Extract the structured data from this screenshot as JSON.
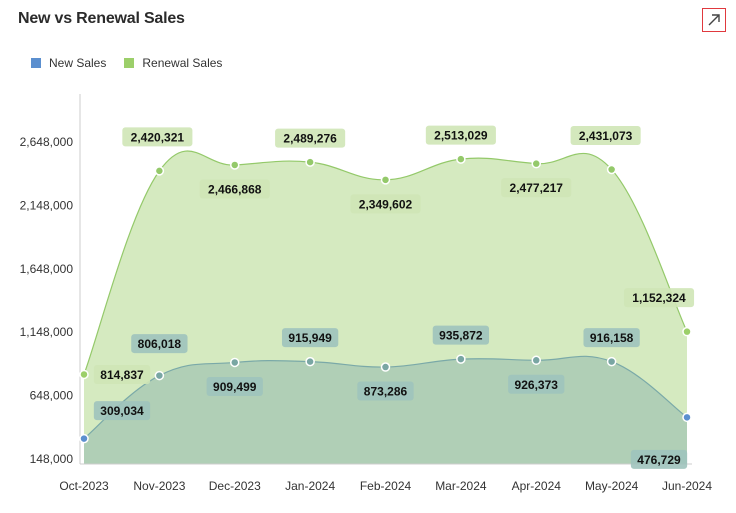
{
  "header": {
    "title": "New vs Renewal Sales",
    "expand_icon": "arrow-up-right-icon"
  },
  "legend": [
    {
      "label": "New Sales",
      "color": "#5b8fcf"
    },
    {
      "label": "Renewal Sales",
      "color": "#9ccf6a"
    }
  ],
  "chart_data": {
    "type": "area",
    "title": "New vs Renewal Sales",
    "xlabel": "",
    "ylabel": "",
    "categories": [
      "Oct-2023",
      "Nov-2023",
      "Dec-2023",
      "Jan-2024",
      "Feb-2024",
      "Mar-2024",
      "Apr-2024",
      "May-2024",
      "Jun-2024"
    ],
    "y_ticks": [
      148000,
      648000,
      1148000,
      1648000,
      2148000,
      2648000
    ],
    "y_tick_labels": [
      "148,000",
      "648,000",
      "1,148,000",
      "1,648,000",
      "2,148,000",
      "2,648,000"
    ],
    "ylim": [
      148000,
      3070000
    ],
    "grid": false,
    "legend_position": "top-left",
    "series": [
      {
        "name": "Renewal Sales",
        "color": "#9ccf6a",
        "values": [
          814837,
          2420321,
          2466868,
          2489276,
          2349602,
          2513029,
          2477217,
          2431073,
          1152324
        ],
        "labels": [
          "814,837",
          "2,420,321",
          "2,466,868",
          "2,489,276",
          "2,349,602",
          "2,513,029",
          "2,477,217",
          "2,431,073",
          "1,152,324"
        ]
      },
      {
        "name": "New Sales",
        "color": "#5b8fcf",
        "values": [
          309034,
          806018,
          909499,
          915949,
          873286,
          935872,
          926373,
          916158,
          476729
        ],
        "labels": [
          "309,034",
          "806,018",
          "909,499",
          "915,949",
          "873,286",
          "935,872",
          "926,373",
          "916,158",
          "476,729"
        ]
      }
    ]
  }
}
